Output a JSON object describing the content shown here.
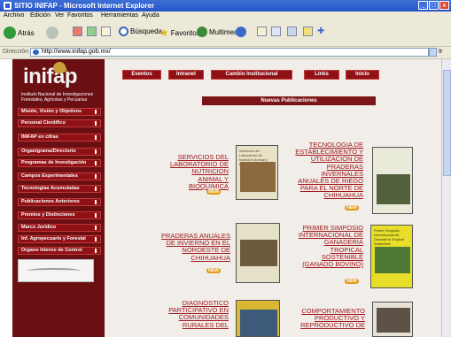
{
  "window": {
    "title": "SITIO INIFAP - Microsoft Internet Explorer",
    "buttons": [
      "_",
      "□",
      "x"
    ]
  },
  "menu": [
    "Archivo",
    "Edición",
    "Ver",
    "Favoritos",
    "Herramientas",
    "Ayuda"
  ],
  "toolbar": {
    "back_label": "Atrás",
    "search_label": "Búsqueda",
    "favorites_label": "Favoritos",
    "media_label": "Multimedia"
  },
  "address": {
    "label": "Dirección",
    "url": "http://www.inifap.gob.mx/",
    "go_label": "Ir"
  },
  "site": {
    "logo_text": "inifap",
    "logo_subtitle": "Instituto Nacional de Investigaciones Forestales, Agrícolas y Pecuarias",
    "top_nav": [
      "Eventos",
      "Intranet",
      "Cambio Institucional",
      "Links",
      "Inicio"
    ],
    "side_nav": [
      "Misión, Visión y Objetivos",
      "Personal Científico",
      "INIFAP en cifras",
      "Organigrama/Directorio",
      "Programas de Investigación",
      "Campos Experimentales",
      "Tecnologías Acumuladas",
      "Publicaciones Anteriores",
      "Premios y Distinciones",
      "Marco Jurídico",
      "Inf. Agropecuario y Forestal",
      "Órgano Interno de Control"
    ],
    "section_title": "Nuevas Publicaciones",
    "badge": "NEW",
    "publications": [
      "SERVICIOS DEL LABORATORIO DE NUTRICION ANIMAL Y BIOQUIMICA",
      "TECNOLOGIA DE ESTABLECIMIENTO Y UTILIZACION DE PRADERAS INVERNALES ANUALES DE RIEGO PARA EL NORTE DE CHIHUAHUA",
      "PRADERAS ANUALES DE INVIERNO EN EL NOROESTE DE CHIHUAHUA",
      "PRIMER SIMPOSIO INTERNACIONAL DE GANADERIA TROPICAL SOSTENIBLE (GANADO BOVINO)",
      "DIAGNOSTICO PARTICIPATIVO EN COMUNIDADES RURALES DEL",
      "COMPORTAMIENTO PRODUCTIVO Y REPRODUCTIVO DE"
    ],
    "book_covers": [
      "Servicios del Laboratorio de Nutrición Animal y Bioquímica",
      "",
      "",
      "Primer Simposio Internacional de Ganadería Tropical Sostenible",
      "",
      ""
    ]
  }
}
